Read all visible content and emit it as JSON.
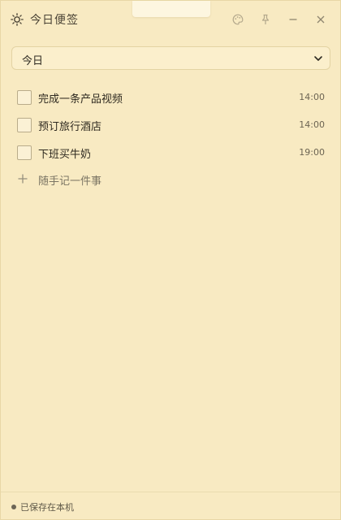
{
  "app": {
    "title": "今日便签",
    "icons": {
      "title": "sun-icon",
      "color": "palette-icon",
      "pin": "pin-icon",
      "minimize": "minimize-icon",
      "close": "close-icon"
    },
    "colors": {
      "background": "#f8eac2",
      "border": "#e8d7a6",
      "text": "#2f2a20",
      "muted": "#7b7564"
    }
  },
  "filter": {
    "selected": "今日",
    "options": [
      "今日"
    ]
  },
  "todos": [
    {
      "text": "完成一条产品视频",
      "time": "14:00",
      "checked": false
    },
    {
      "text": "预订旅行酒店",
      "time": "14:00",
      "checked": false
    },
    {
      "text": "下班买牛奶",
      "time": "19:00",
      "checked": false
    }
  ],
  "add": {
    "label": "随手记一件事"
  },
  "footer": {
    "status": "已保存在本机"
  }
}
